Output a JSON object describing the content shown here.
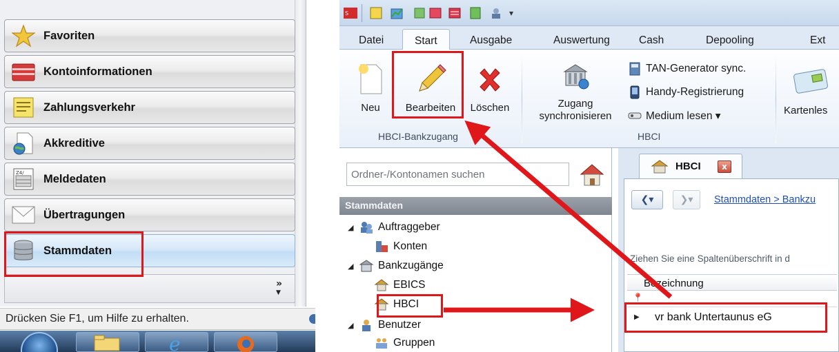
{
  "left_app": {
    "nav_items": [
      {
        "label": "Favoriten",
        "icon": "star-icon"
      },
      {
        "label": "Kontoinformationen",
        "icon": "folder-red-icon"
      },
      {
        "label": "Zahlungsverkehr",
        "icon": "document-yellow-icon"
      },
      {
        "label": "Akkreditive",
        "icon": "document-globe-icon"
      },
      {
        "label": "Meldedaten",
        "icon": "report-form-icon"
      },
      {
        "label": "Übertragungen",
        "icon": "envelope-icon"
      },
      {
        "label": "Stammdaten",
        "icon": "database-icon",
        "active": true
      }
    ],
    "more_chevron": "»",
    "status_text": "Drücken Sie F1, um Hilfe zu erhalten."
  },
  "right_app": {
    "ribbon_tabs": [
      "Datei",
      "Start",
      "Ausgabe",
      "Auswertung",
      "Cash",
      "Depooling",
      "Ext"
    ],
    "active_tab": "Start",
    "ribbon_groups": {
      "hbci_bankzugang": {
        "label": "HBCI-Bankzugang",
        "buttons": {
          "new": "Neu",
          "edit": "Bearbeiten",
          "delete": "Löschen"
        }
      },
      "sync": {
        "line1": "Zugang",
        "line2": "synchronisieren"
      },
      "hbci": {
        "label": "HBCI",
        "items": {
          "tan_generator": "TAN-Generator sync.",
          "handy": "Handy-Registrierung",
          "medium": "Medium lesen ▾"
        }
      },
      "card_reader": {
        "label": "Kartenles"
      }
    },
    "search": {
      "placeholder": "Ordner-/Kontonamen suchen"
    },
    "tree": {
      "header": "Stammdaten",
      "nodes": {
        "auftraggeber": "Auftraggeber",
        "konten": "Konten",
        "bankzugaenge": "Bankzugänge",
        "ebics": "EBICS",
        "hbci": "HBCI",
        "benutzer": "Benutzer",
        "gruppen": "Gruppen"
      }
    },
    "document": {
      "tab_label": "HBCI",
      "close_glyph": "x",
      "breadcrumb": "Stammdaten > Bankzu",
      "group_hint": "Ziehen Sie eine Spaltenüberschrift in d",
      "column_header": "Bezeichnung",
      "rows": [
        "vr bank Untertaunus eG"
      ]
    }
  },
  "colors": {
    "highlight": "#e0171a",
    "arrow": "#e0171a",
    "ribbon_bg": "#e9f0f9",
    "link": "#1f4fb6"
  }
}
